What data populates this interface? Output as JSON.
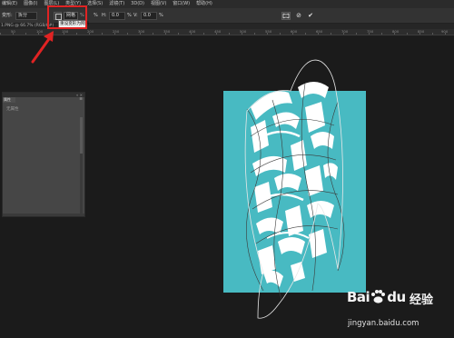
{
  "menubar": {
    "items": [
      "编辑(E)",
      "图像(I)",
      "图层(L)",
      "类型(Y)",
      "选择(S)",
      "滤镜(T)",
      "3D(D)",
      "视图(V)",
      "窗口(W)",
      "帮助(H)"
    ]
  },
  "options": {
    "tool_label": "变形:",
    "mode_value": "拆分",
    "warp_label": "网格",
    "h_label": "H:",
    "h_value": "0.0",
    "v_label": "V:",
    "v_value": "0.0",
    "percent": "%",
    "tooltip": "重设变形为网格",
    "commit_icons": [
      "warp-mode-icon",
      "cancel-icon",
      "commit-icon"
    ],
    "cancel_glyph": "⊘",
    "commit_glyph": "✔"
  },
  "document_tab": "1.PNG @ 66.7% (RGB/8#)",
  "ruler_labels": [
    "50",
    "100",
    "150",
    "200",
    "250",
    "300",
    "350",
    "400",
    "450",
    "500",
    "550",
    "600",
    "650",
    "700",
    "750",
    "800",
    "850",
    "900"
  ],
  "panel": {
    "tab_label": "属性",
    "empty_text": "无属性",
    "controls": "«  ×",
    "menu_glyph": "≡"
  },
  "watermark": {
    "brand": "Bai",
    "paw": "paw-icon",
    "brand_tail": "du",
    "cn": "经验",
    "url": "jingyan.baidu.com"
  },
  "colors": {
    "document_bg": "#48bac2",
    "highlight": "#e02323",
    "arrow": "#e02323"
  }
}
